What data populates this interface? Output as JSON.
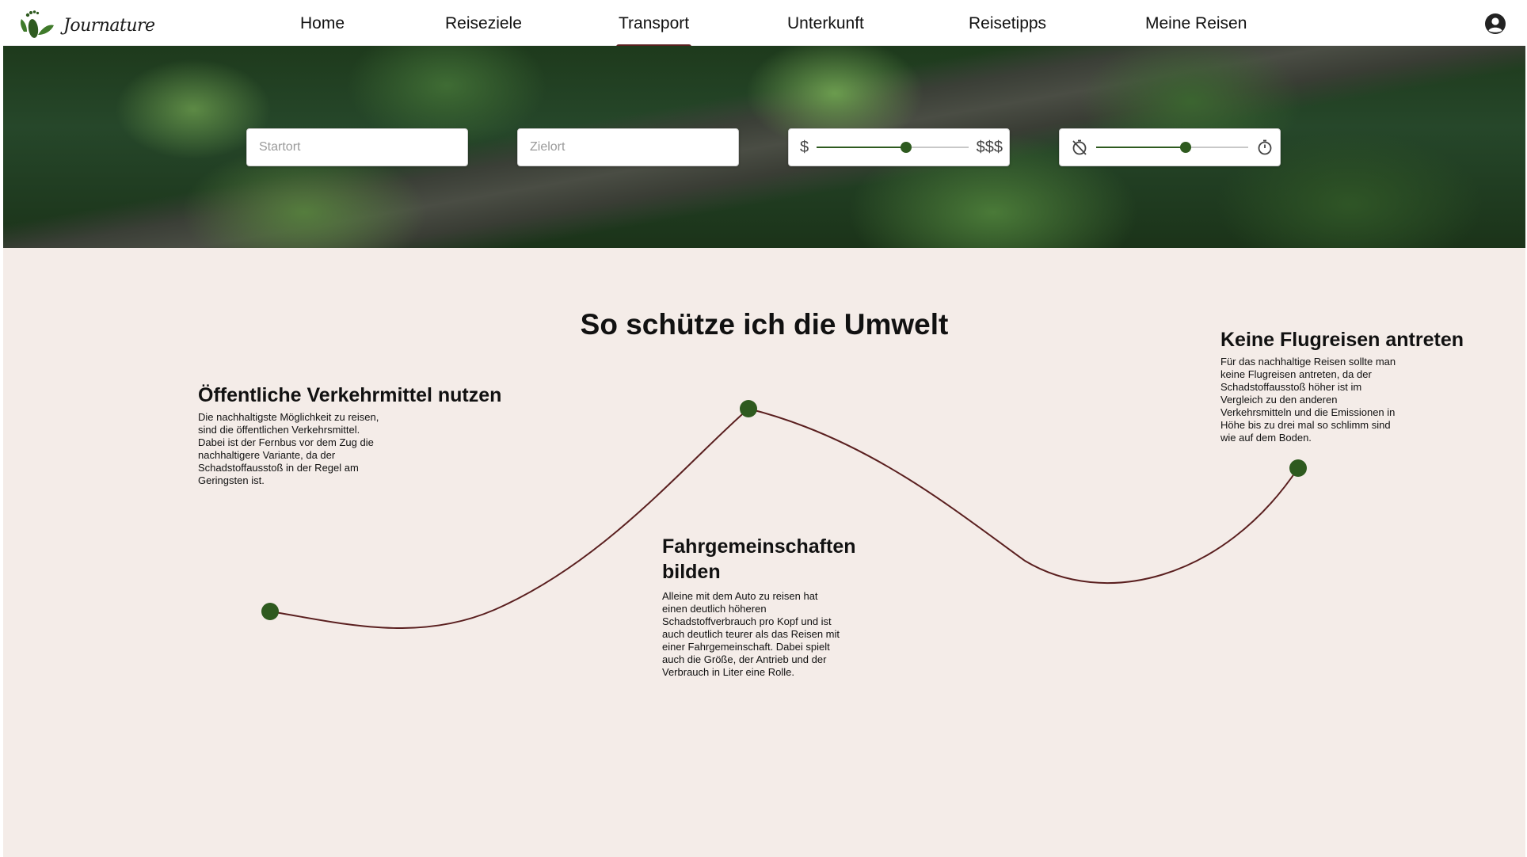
{
  "brand": {
    "name": "Journature"
  },
  "nav": {
    "items": [
      {
        "label": "Home"
      },
      {
        "label": "Reiseziele"
      },
      {
        "label": "Transport",
        "active": true
      },
      {
        "label": "Unterkunft"
      },
      {
        "label": "Reisetipps"
      },
      {
        "label": "Meine Reisen"
      }
    ],
    "account_icon": "account-circle-icon"
  },
  "search": {
    "start_placeholder": "Startort",
    "start_value": "",
    "destination_placeholder": "Zielort",
    "destination_value": "",
    "price": {
      "min_label": "$",
      "max_label": "$$$",
      "level": 0.59
    },
    "duration": {
      "min_icon": "timer-off-icon",
      "max_icon": "timer-icon",
      "level": 0.59
    }
  },
  "main": {
    "title": "So schütze ich die Umwelt",
    "tips": [
      {
        "title": "Öffentliche Verkehrmittel nutzen",
        "lines": [
          "Die nachhaltigste Möglichkeit zu reisen,",
          "sind die öffentlichen Verkehrsmittel.",
          "Dabei ist der Fernbus vor dem Zug die",
          "nachhaltigere Variante, da der",
          "Schadstoffausstoß in der Regel am",
          "Geringsten ist."
        ]
      },
      {
        "title_lines": [
          "Fahrgemeinschaften",
          "bilden"
        ],
        "lines": [
          "Alleine mit dem Auto zu reisen hat",
          "einen deutlich höheren",
          "Schadstoffverbrauch pro Kopf und ist",
          "auch deutlich teurer als das Reisen mit",
          "einer Fahrgemeinschaft. Dabei spielt",
          "auch die Größe, der Antrieb und der",
          "Verbrauch in Liter eine Rolle."
        ]
      },
      {
        "title": "Keine Flugreisen antreten",
        "lines": [
          "Für das nachhaltige Reisen sollte man",
          "keine Flugreisen antreten, da der",
          "Schadstoffausstoß höher ist im",
          "Vergleich zu den anderen",
          "Verkehrsmitteln und die Emissionen in",
          "Höhe bis zu drei mal so schlimm sind",
          "wie auf dem Boden."
        ]
      }
    ]
  },
  "colors": {
    "accent_green": "#2e5a1f",
    "curve": "#5a1f1f",
    "background": "#f4ece8"
  }
}
